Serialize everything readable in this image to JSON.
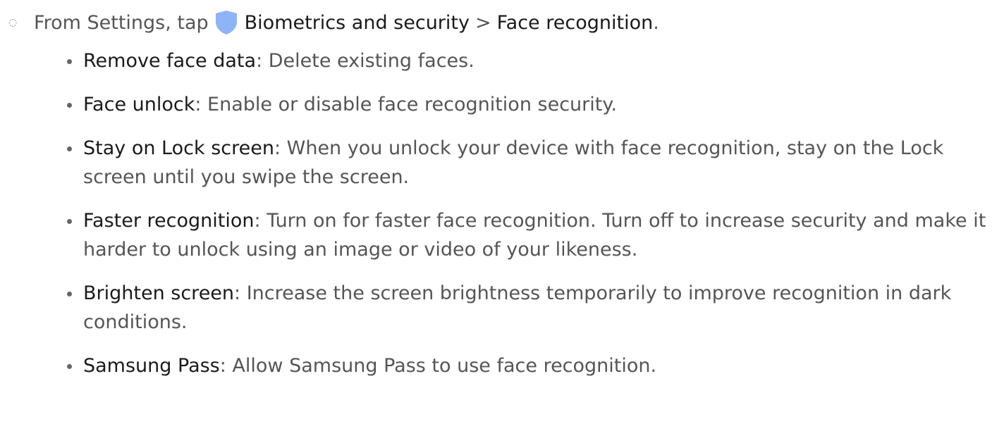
{
  "step": {
    "prefix": "From Settings, tap",
    "app_icon": "shield-icon",
    "app_icon_color": "#8fb4f5",
    "menu_1": "Biometrics and security",
    "separator": ">",
    "menu_2": "Face recognition",
    "suffix": "."
  },
  "options": [
    {
      "term": "Remove face data",
      "desc": ": Delete existing faces."
    },
    {
      "term": "Face unlock",
      "desc": ": Enable or disable face recognition security."
    },
    {
      "term": "Stay on Lock screen",
      "desc": ": When you unlock your device with face recognition, stay on the Lock screen until you swipe the screen."
    },
    {
      "term": "Faster recognition",
      "desc": ": Turn on for faster face recognition. Turn off to increase security and make it harder to unlock using an image or video of your likeness."
    },
    {
      "term": "Brighten screen",
      "desc": ": Increase the screen brightness temporarily to improve recognition in dark conditions."
    },
    {
      "term": "Samsung Pass",
      "desc": ": Allow Samsung Pass to use face recognition."
    }
  ]
}
